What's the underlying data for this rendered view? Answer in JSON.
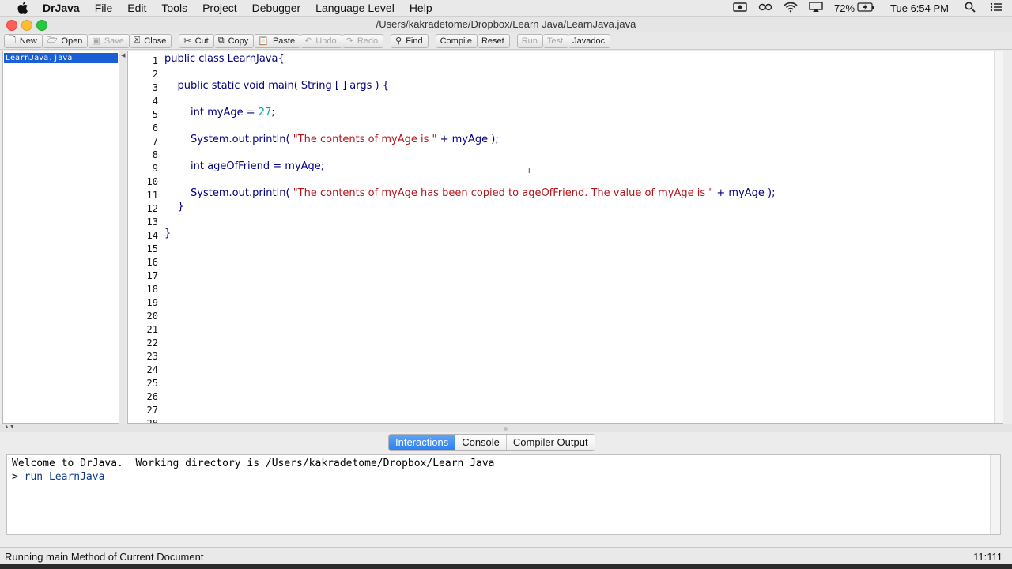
{
  "menubar": {
    "app_name": "DrJava",
    "items": [
      "File",
      "Edit",
      "Tools",
      "Project",
      "Debugger",
      "Language Level",
      "Help"
    ],
    "battery": "72%",
    "clock": "Tue 6:54 PM"
  },
  "window": {
    "title": "/Users/kakradetome/Dropbox/Learn Java/LearnJava.java"
  },
  "toolbar": {
    "new": "New",
    "open": "Open",
    "save": "Save",
    "close": "Close",
    "cut": "Cut",
    "copy": "Copy",
    "paste": "Paste",
    "undo": "Undo",
    "redo": "Redo",
    "find": "Find",
    "compile": "Compile",
    "reset": "Reset",
    "run": "Run",
    "test": "Test",
    "javadoc": "Javadoc"
  },
  "documents": [
    "LearnJava.java"
  ],
  "editor": {
    "line_numbers": [
      "1",
      "2",
      "3",
      "4",
      "5",
      "6",
      "7",
      "8",
      "9",
      "10",
      "11",
      "12",
      "13",
      "14",
      "15",
      "16",
      "17",
      "18",
      "19",
      "20",
      "21",
      "22",
      "23",
      "24",
      "25",
      "26",
      "27",
      "28"
    ],
    "lines": {
      "l1": "public class LearnJava{",
      "l3": "    public static void main( String [ ] args ) {",
      "l5a": "        int myAge = ",
      "l5b": "27",
      "l5c": ";",
      "l7a": "        System.out.println( ",
      "l7b": "\"The contents of myAge is \"",
      "l7c": " + myAge );",
      "l9": "        int ageOfFriend = myAge;",
      "l11a": "        System.out.println( ",
      "l11b": "\"The contents of myAge has been copied to ageOfFriend. The value of myAge is \"",
      "l11c": " + myAge );",
      "l12": "    }",
      "l14": "}"
    }
  },
  "tabs": {
    "interactions": "Interactions",
    "console": "Console",
    "compiler_output": "Compiler Output"
  },
  "interactions": {
    "welcome": "Welcome to DrJava.  Working directory is /Users/kakradetome/Dropbox/Learn Java",
    "prompt": "> ",
    "command": "run LearnJava"
  },
  "status": {
    "message": "Running main Method of Current Document",
    "position": "11:111"
  }
}
